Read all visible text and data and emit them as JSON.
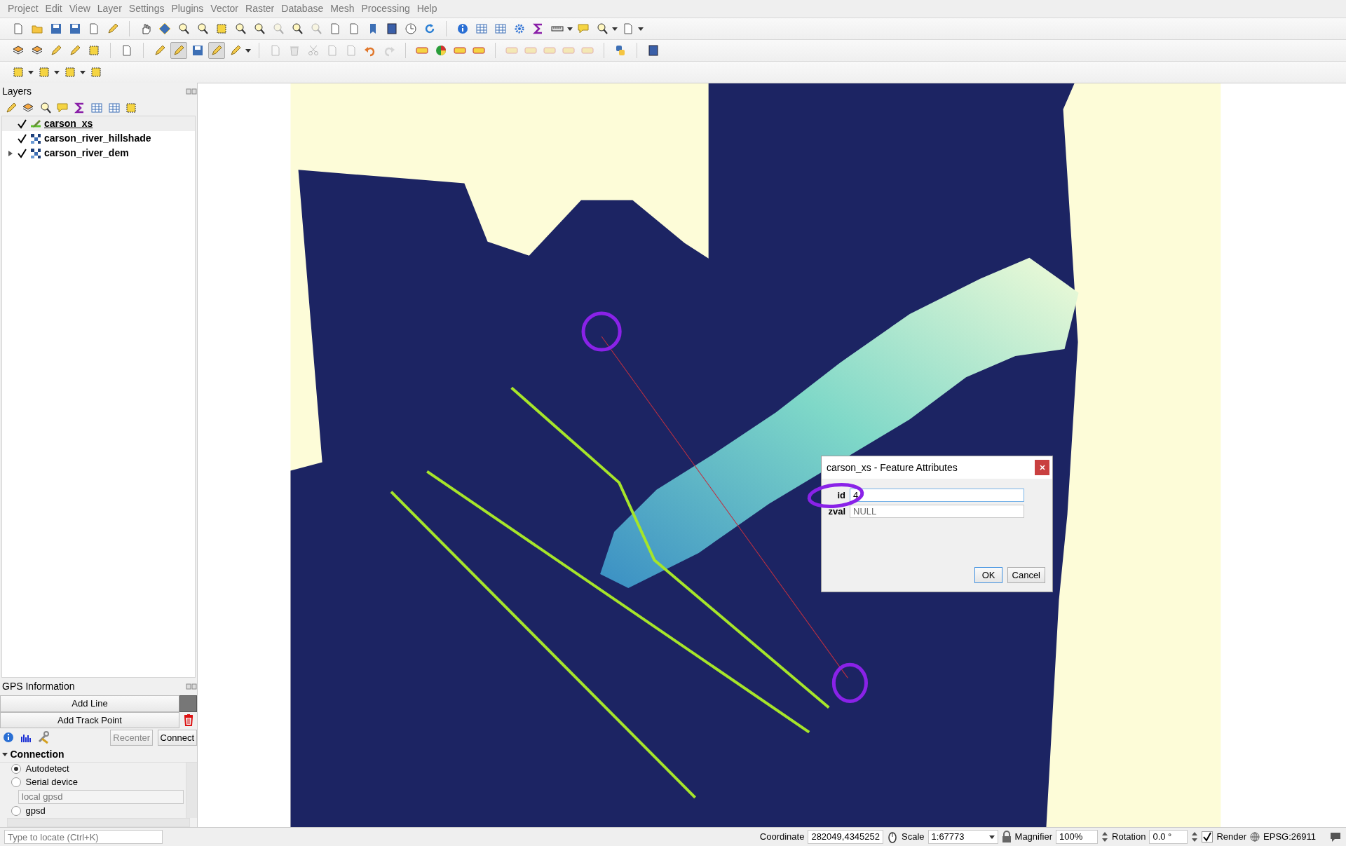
{
  "menu": [
    "Project",
    "Edit",
    "View",
    "Layer",
    "Settings",
    "Plugins",
    "Vector",
    "Raster",
    "Database",
    "Mesh",
    "Processing",
    "Help"
  ],
  "toolbars": [
    {
      "items": [
        {
          "disabled": false
        },
        {
          "disabled": false
        },
        {
          "disabled": false
        },
        {
          "disabled": false
        },
        {
          "disabled": false
        },
        {
          "disabled": false
        },
        {
          "disabled": false
        },
        {
          "disabled": false
        },
        {
          "disabled": false
        },
        {
          "disabled": false
        },
        {
          "disabled": false
        },
        {
          "disabled": false
        },
        {
          "disabled": false
        },
        {
          "disabled": true
        },
        {
          "disabled": false
        },
        {
          "disabled": true
        },
        {
          "disabled": false
        },
        {
          "disabled": false
        },
        {
          "disabled": false
        },
        {
          "disabled": false
        },
        {
          "disabled": false
        },
        {
          "disabled": false
        },
        {
          "disabled": false
        },
        {
          "disabled": false
        },
        {
          "disabled": false
        },
        {
          "disabled": false
        },
        {
          "disabled": false
        },
        {
          "disabled": false
        },
        {
          "disabled": false
        },
        {
          "disabled": false
        },
        {
          "disabled": false
        }
      ]
    },
    {
      "items": [
        {
          "disabled": false,
          "on": false
        },
        {
          "disabled": false,
          "on": false
        },
        {
          "disabled": false,
          "on": false
        },
        {
          "disabled": false,
          "on": false
        },
        {
          "disabled": false,
          "on": false
        },
        {
          "disabled": false,
          "on": false
        },
        {
          "disabled": false,
          "on": false
        },
        {
          "disabled": false,
          "on": true
        },
        {
          "disabled": false,
          "on": false
        },
        {
          "disabled": false,
          "on": true
        },
        {
          "disabled": false,
          "on": false
        },
        {
          "disabled": true,
          "on": false
        },
        {
          "disabled": true,
          "on": false
        },
        {
          "disabled": true,
          "on": false
        },
        {
          "disabled": true,
          "on": false
        },
        {
          "disabled": true,
          "on": false
        },
        {
          "disabled": false,
          "on": false
        },
        {
          "disabled": true,
          "on": false
        },
        {
          "disabled": false,
          "on": false
        },
        {
          "disabled": false,
          "on": false
        },
        {
          "disabled": false,
          "on": false
        },
        {
          "disabled": false,
          "on": false
        },
        {
          "disabled": true,
          "on": false
        },
        {
          "disabled": true,
          "on": false
        },
        {
          "disabled": true,
          "on": false
        },
        {
          "disabled": true,
          "on": false
        },
        {
          "disabled": true,
          "on": false
        },
        {
          "disabled": false,
          "on": false
        },
        {
          "disabled": false,
          "on": false
        }
      ]
    },
    {
      "items": [
        {
          "disabled": false
        },
        {
          "disabled": false
        },
        {
          "disabled": false
        },
        {
          "disabled": false
        }
      ]
    }
  ],
  "layers_panel": {
    "title": "Layers",
    "layers": [
      {
        "name": "carson_xs",
        "kind": "vector",
        "checked": true,
        "selected": true,
        "editing": true,
        "expandable": false
      },
      {
        "name": "carson_river_hillshade",
        "kind": "raster",
        "checked": true,
        "selected": false,
        "editing": false,
        "expandable": false
      },
      {
        "name": "carson_river_dem",
        "kind": "raster",
        "checked": true,
        "selected": false,
        "editing": false,
        "expandable": true
      }
    ]
  },
  "gps_panel": {
    "title": "GPS Information",
    "add_line": "Add Line",
    "add_track_point": "Add Track Point",
    "recenter": {
      "label": "Recenter",
      "disabled": true
    },
    "connect": {
      "label": "Connect",
      "disabled": false
    },
    "section": {
      "title": "Connection",
      "expanded": true
    },
    "options": [
      {
        "kind": "radio",
        "label": "Autodetect",
        "selected": true
      },
      {
        "kind": "radio",
        "label": "Serial device",
        "selected": false
      },
      {
        "kind": "field",
        "placeholder": "local gpsd"
      },
      {
        "kind": "radio",
        "label": "gpsd",
        "selected": false
      }
    ]
  },
  "locator": {
    "placeholder": "Type to locate (Ctrl+K)"
  },
  "dialog": {
    "title": "carson_xs - Feature Attributes",
    "fields": [
      {
        "label": "id",
        "value": "4",
        "focused": true
      },
      {
        "label": "zval",
        "placeholder": "NULL",
        "focused": false
      }
    ],
    "buttons": [
      {
        "label": "OK",
        "default": true
      },
      {
        "label": "Cancel",
        "default": false
      }
    ]
  },
  "status_bar": {
    "coordinate_label": "Coordinate",
    "coordinate": "282049,4345252",
    "scale_label": "Scale",
    "scale": "1:67773",
    "magnifier_label": "Magnifier",
    "magnifier": "100%",
    "rotation_label": "Rotation",
    "rotation": "0.0 °",
    "render": {
      "label": "Render",
      "checked": true
    },
    "crs": "EPSG:26911"
  }
}
